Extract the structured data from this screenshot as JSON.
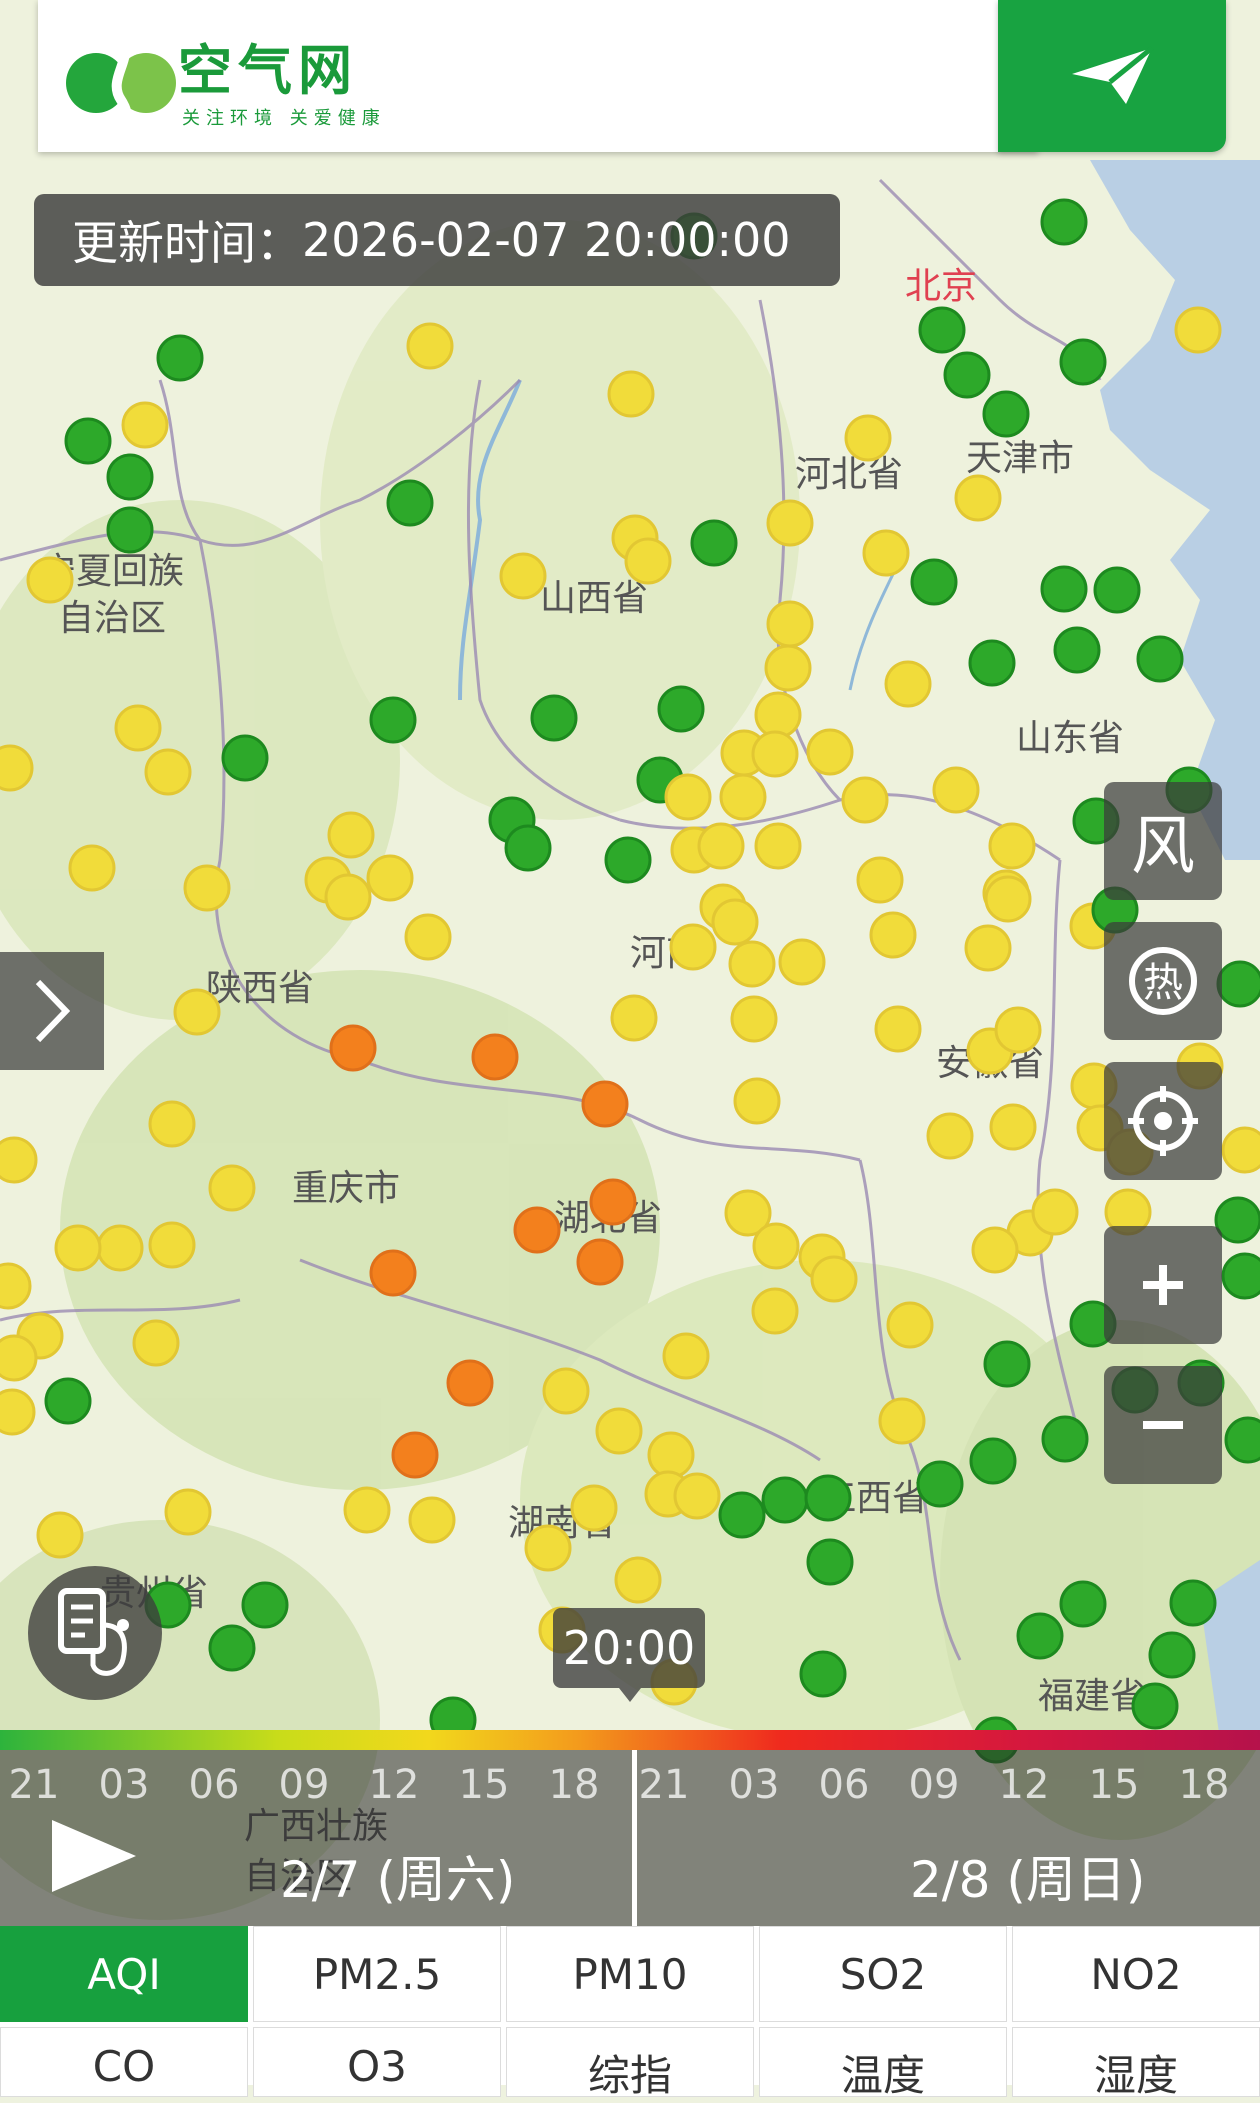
{
  "header": {
    "logo_title": "空气网",
    "logo_subtitle": "关注环境 关爱健康"
  },
  "update_time": {
    "label": "更新时间：",
    "value": "2026-02-07 20:00:00"
  },
  "map": {
    "labels": [
      "北京",
      "天津市",
      "河北省",
      "山西省",
      "宁夏回族",
      "自治区",
      "山东省",
      "河南",
      "陕西省",
      "安徽省",
      "湖北省",
      "重庆市",
      "湖南省",
      "江西省",
      "贵州省",
      "福建省",
      "广西壮族",
      "自治区"
    ],
    "station_colors": {
      "good": "#2da92a",
      "moderate": "#f1dc3a",
      "unhealthy_sensitive": "#f3801d"
    }
  },
  "side_buttons": [
    {
      "name": "wind",
      "glyph": "风"
    },
    {
      "name": "hot",
      "glyph": "热"
    },
    {
      "name": "locate",
      "glyph": "◎"
    },
    {
      "name": "zoom-in",
      "glyph": "+"
    },
    {
      "name": "zoom-out",
      "glyph": "−"
    }
  ],
  "timeline": {
    "current_time": "20:00",
    "hours": [
      "21",
      "03",
      "06",
      "09",
      "12",
      "15",
      "18",
      "21",
      "03",
      "06",
      "09",
      "12",
      "15",
      "18"
    ],
    "day1": "2/7 (周六)",
    "day2": "2/8 (周日)"
  },
  "tabs_row1": [
    "AQI",
    "PM2.5",
    "PM10",
    "SO2",
    "NO2"
  ],
  "tabs_row2": [
    "CO",
    "O3",
    "综指",
    "温度",
    "湿度"
  ],
  "active_tab": "AQI"
}
